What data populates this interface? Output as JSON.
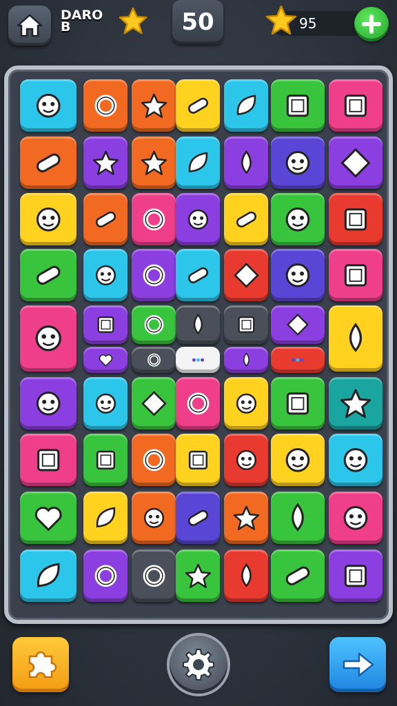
{
  "header": {
    "player_name_line1": "DARO",
    "player_name_line2": "B",
    "level": "50",
    "star_count": "95",
    "icons": [
      "home-icon",
      "star-icon",
      "plus-icon"
    ]
  },
  "colors": {
    "orange": "#f26a22",
    "cyan": "#2cc6ea",
    "green": "#39c43e",
    "pink": "#ef3f8a",
    "yellow": "#ffd21f",
    "purple": "#8c3fe0",
    "red": "#e83a2e",
    "teal": "#1aa5a0",
    "indigo": "#5a46d6",
    "dark": "#4a4f59",
    "white": "#f4f4f4"
  },
  "board": {
    "rows": [
      [
        {
          "color": "cyan",
          "icon": "cat-face-icon"
        },
        {
          "color": "orange",
          "icon": "letter-s-icon"
        },
        {
          "color": "orange",
          "icon": "star-icon"
        },
        {
          "color": "yellow",
          "icon": "paintbrush-icon"
        },
        {
          "color": "cyan",
          "icon": "feather-icon"
        },
        {
          "color": "green",
          "icon": "picture-frame-icon"
        },
        {
          "color": "pink",
          "icon": "picture-frame-icon"
        }
      ],
      [
        {
          "color": "orange",
          "icon": "scroll-icon"
        },
        {
          "color": "purple",
          "icon": "star-icon"
        },
        {
          "color": "orange",
          "icon": "star-icon"
        },
        {
          "color": "cyan",
          "icon": "leaf-icon"
        },
        {
          "color": "purple",
          "icon": "flame-icon"
        },
        {
          "color": "indigo",
          "icon": "cloud-face-icon"
        },
        {
          "color": "purple",
          "icon": "diamond-icon"
        }
      ],
      [
        {
          "color": "yellow",
          "icon": "monster-icon"
        },
        {
          "color": "orange",
          "icon": "hammer-icon"
        },
        {
          "color": "pink",
          "icon": "moon-icon"
        },
        {
          "color": "purple",
          "icon": "bear-face-icon"
        },
        {
          "color": "yellow",
          "icon": "pen-icon"
        },
        {
          "color": "green",
          "icon": "sun-face-icon"
        },
        {
          "color": "red",
          "icon": "battery-icon"
        }
      ],
      [
        {
          "color": "green",
          "icon": "capsule-icon"
        },
        {
          "color": "cyan",
          "icon": "pig-face-icon"
        },
        {
          "color": "purple",
          "icon": "eye-icon"
        },
        {
          "color": "cyan",
          "icon": "pencil-icon"
        },
        {
          "color": "red",
          "icon": "gem-icon"
        },
        {
          "color": "indigo",
          "icon": "globe-icon"
        },
        {
          "color": "pink",
          "icon": "picture-frame-icon"
        }
      ],
      [
        {
          "color": "pink",
          "icon": "jellyfish-icon"
        },
        {
          "color": "purple",
          "icon": "battery-icon"
        },
        {
          "color": "green",
          "icon": "target-icon"
        },
        {
          "color": "dark",
          "icon": "bulb-icon"
        },
        {
          "color": "dark",
          "icon": "square-icon"
        },
        {
          "color": "purple",
          "icon": "compass-icon"
        },
        {
          "color": "yellow",
          "icon": "diving-helmet-icon"
        }
      ],
      [
        {
          "color": "purple",
          "icon": "heart-icon"
        },
        {
          "color": "dark",
          "icon": "magnifier-icon"
        },
        {
          "color": "white",
          "icon": "dots-icon"
        },
        {
          "color": "purple",
          "icon": "drop-icon"
        },
        {
          "color": "red",
          "icon": "percent-icon"
        }
      ],
      [
        {
          "color": "purple",
          "icon": "cat-face-icon"
        },
        {
          "color": "cyan",
          "icon": "sun-face-icon"
        },
        {
          "color": "green",
          "icon": "gem-icon"
        },
        {
          "color": "pink",
          "icon": "ring-icon"
        },
        {
          "color": "yellow",
          "icon": "monster-icon"
        },
        {
          "color": "green",
          "icon": "robot-face-icon"
        },
        {
          "color": "teal",
          "icon": "sun-icon"
        }
      ],
      [
        {
          "color": "pink",
          "icon": "bag-icon"
        },
        {
          "color": "green",
          "icon": "envelope-icon"
        },
        {
          "color": "orange",
          "icon": "moon-icon"
        },
        {
          "color": "yellow",
          "icon": "envelope-icon"
        },
        {
          "color": "red",
          "icon": "fire-face-icon"
        },
        {
          "color": "yellow",
          "icon": "lion-face-icon"
        },
        {
          "color": "cyan",
          "icon": "fish-face-icon"
        }
      ],
      [
        {
          "color": "green",
          "icon": "apple-icon"
        },
        {
          "color": "yellow",
          "icon": "grape-icon"
        },
        {
          "color": "orange",
          "icon": "skull-icon"
        },
        {
          "color": "indigo",
          "icon": "pencil-icon"
        },
        {
          "color": "orange",
          "icon": "star-icon"
        },
        {
          "color": "green",
          "icon": "ice-cream-icon"
        },
        {
          "color": "pink",
          "icon": "globe-icon"
        }
      ],
      [
        {
          "color": "cyan",
          "icon": "leaf-icon"
        },
        {
          "color": "purple",
          "icon": "ring-icon"
        },
        {
          "color": "dark",
          "icon": "swirl-icon"
        },
        {
          "color": "green",
          "icon": "star-icon"
        },
        {
          "color": "red",
          "icon": "potion-icon"
        },
        {
          "color": "green",
          "icon": "pen-icon"
        },
        {
          "color": "purple",
          "icon": "envelope-icon"
        }
      ]
    ]
  },
  "footer": {
    "buttons": [
      "puzzle-icon",
      "gear-icon",
      "arrow-right-icon"
    ]
  }
}
